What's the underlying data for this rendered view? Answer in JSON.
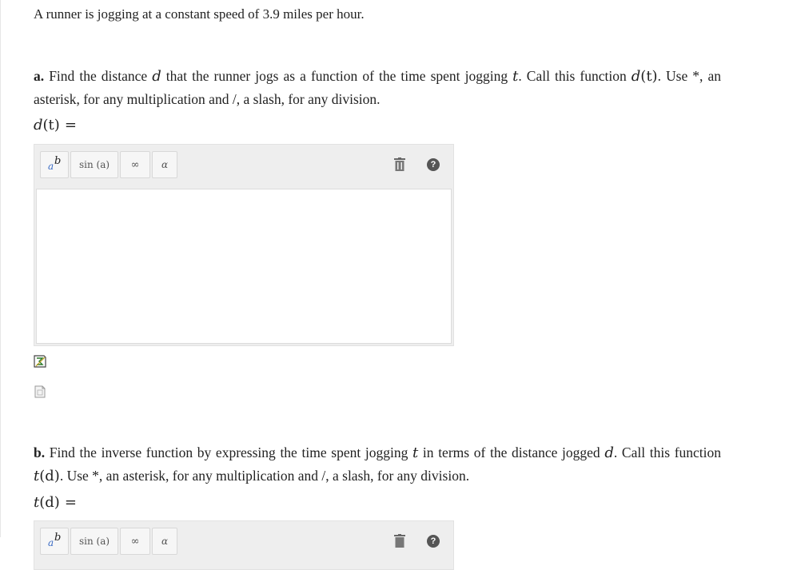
{
  "intro": "A runner is jogging at a constant speed of 3.9 miles per hour.",
  "part_a": {
    "letter": "a.",
    "text_1": "Find the distance",
    "var_d": "d",
    "text_2": "that the runner jogs as a function of the time spent jogging",
    "var_t": "t",
    "text_3": ". Call this function",
    "fn": "d",
    "fn_arg": "(t)",
    "text_4": ". Use *, an asterisk, for any multiplication and /, a slash, for any division.",
    "label_fn": "d",
    "label_arg": "(t)",
    "label_eq": "="
  },
  "part_b": {
    "letter": "b.",
    "text_1": "Find the inverse function by expressing the time spent jogging",
    "var_t": "t",
    "text_2": "in terms of the distance jogged",
    "var_d": "d",
    "text_3": ". Call this function",
    "fn": "t",
    "fn_arg": "(d)",
    "text_4": ". Use *, an asterisk, for any multiplication and /, a slash, for any division.",
    "label_fn": "t",
    "label_arg": "(d)",
    "label_eq": "="
  },
  "toolbar": {
    "power_base": "a",
    "power_exp": "b",
    "sin_label": "sin (a)",
    "inf_label": "∞",
    "greek_label": "α",
    "help_label": "?"
  },
  "colors": {
    "panel": "#eeeeee",
    "accent_blue": "#3a6bc4"
  }
}
